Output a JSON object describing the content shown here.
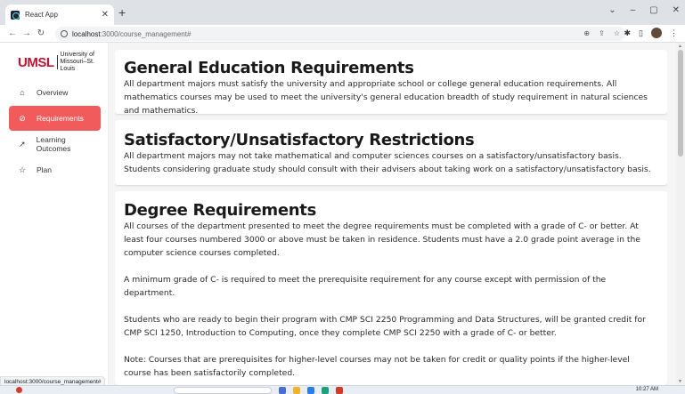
{
  "browser": {
    "tab_title": "React App",
    "tab_close": "✕",
    "new_tab": "+",
    "url_host": "localhost",
    "url_path": ":3000/course_management#",
    "window_controls": [
      "⌄",
      "–",
      "▢",
      "✕"
    ]
  },
  "sidebar": {
    "logo_mark": "UMSL",
    "logo_line1": "University of",
    "logo_line2": "Missouri–St. Louis",
    "items": [
      {
        "label": "Overview",
        "icon": "home-icon",
        "glyph": "⌂",
        "active": false
      },
      {
        "label": "Requirements",
        "icon": "check-circle-icon",
        "glyph": "⊘",
        "active": true
      },
      {
        "label": "Learning Outcomes",
        "icon": "trending-up-icon",
        "glyph": "↗",
        "active": false
      },
      {
        "label": "Plan",
        "icon": "star-icon",
        "glyph": "☆",
        "active": false
      }
    ]
  },
  "main": {
    "sections": [
      {
        "title": "General Education Requirements",
        "paragraphs": [
          "All department majors must satisfy the university and appropriate school or college general education requirements. All mathematics courses may be used to meet the university's general education breadth of study requirement in natural sciences and mathematics."
        ]
      },
      {
        "title": "Satisfactory/Unsatisfactory Restrictions",
        "paragraphs": [
          "All department majors may not take mathematical and computer sciences courses on a satisfactory/unsatisfactory basis. Students considering graduate study should consult with their advisers about taking work on a satisfactory/unsatisfactory basis."
        ]
      },
      {
        "title": "Degree Requirements",
        "paragraphs": [
          "All courses of the department presented to meet the degree requirements must be completed with a grade of C- or better. At least four courses numbered 3000 or above must be taken in residence. Students must have a 2.0 grade point average in the computer science courses completed.",
          "A minimum grade of C- is required to meet the prerequisite requirement for any course except with permission of the department.",
          "Students who are ready to begin their program with CMP SCI 2250 Programming and Data Structures, will be granted credit for CMP SCI 1250, Introduction to Computing, once they complete CMP SCI 2250 with a grade of C- or better.",
          "Note: Courses that are prerequisites for higher-level courses may not be taken for credit or quality points if the higher-level course has been satisfactorily completed."
        ]
      }
    ]
  },
  "statusbar": {
    "text": "localhost:3000/course_management#"
  },
  "taskbar": {
    "time": "10:27 AM"
  },
  "colors": {
    "accent": "#f25b5b",
    "brand": "#c8102e"
  }
}
